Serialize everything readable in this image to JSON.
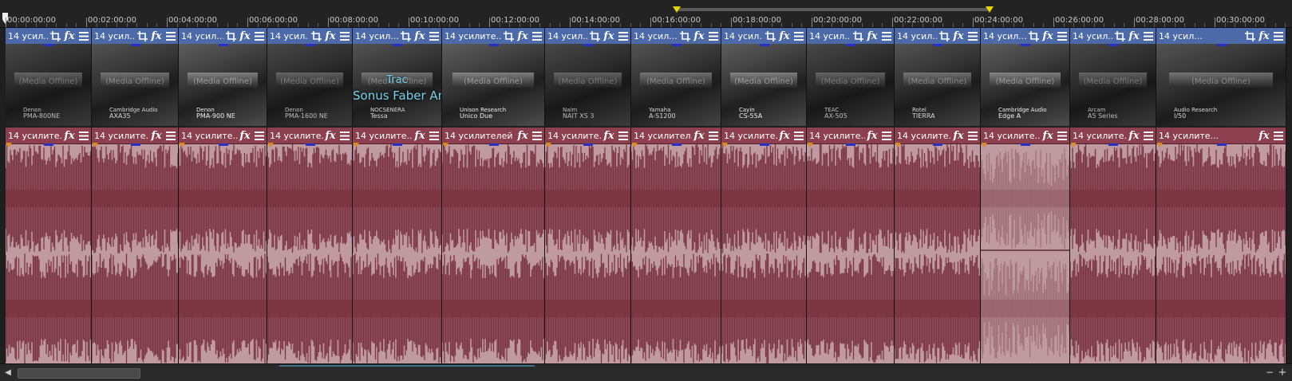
{
  "ruler": {
    "labels": [
      "00:00:00:00",
      "00:02:00:00",
      "00:04:00:00",
      "00:06:00:00",
      "00:08:00:00",
      "00:10:00:00",
      "00:12:00:00",
      "00:14:00:00",
      "00:16:00:00",
      "00:18:00:00",
      "00:20:00:00",
      "00:22:00:00",
      "00:24:00:00",
      "00:26:00:00",
      "00:28:00:00",
      "00:30:00:00"
    ]
  },
  "colors": {
    "video_header": "#4d6aa8",
    "audio_header": "#8c3f4e",
    "waveform": "#7a3442",
    "audio_bg": "#c09aa1",
    "loop_marker": "#e6d200"
  },
  "icons": [
    "crop-icon",
    "fx-icon",
    "menu-icon"
  ],
  "fx_label": "fx",
  "video_clips": [
    {
      "name": "14 усил...",
      "offline": "(Media Offline)",
      "cap1": "Denon",
      "cap2": "PMA-800NE"
    },
    {
      "name": "14 усил...",
      "offline": "(Media Offline)",
      "cap1": "Cambridge Audio",
      "cap2": "AXA35"
    },
    {
      "name": "14 усил...",
      "offline": "(Media Offline)",
      "cap1": "Denon",
      "cap2": "PMA-900 NE"
    },
    {
      "name": "14 усил...",
      "offline": "(Media Offline)",
      "cap1": "Denon",
      "cap2": "PMA-1600 NE"
    },
    {
      "name": "14 усил...",
      "offline": "(Media Offline)",
      "cap1": "NOCSENERA",
      "cap2": "Tessa",
      "overlay1": "Trac",
      "overlay2": "Sonus Faber Ame"
    },
    {
      "name": "14 усилите...",
      "offline": "(Media Offline)",
      "cap1": "Unison Research",
      "cap2": "Unico Due"
    },
    {
      "name": "14 усил...",
      "offline": "(Media Offline)",
      "cap1": "Naim",
      "cap2": "NAIT XS 3"
    },
    {
      "name": "14 усил...",
      "offline": "(Media Offline)",
      "cap1": "Yamaha",
      "cap2": "A-S1200"
    },
    {
      "name": "14 усил...",
      "offline": "(Media Offline)",
      "cap1": "Cayin",
      "cap2": "CS-55A"
    },
    {
      "name": "14 усил...",
      "offline": "(Media Offline)",
      "cap1": "TEAC",
      "cap2": "AX-505"
    },
    {
      "name": "14 усил...",
      "offline": "(Media Offline)",
      "cap1": "Rotel",
      "cap2": "TIERRA"
    },
    {
      "name": "14 усил...",
      "offline": "(Media Offline)",
      "cap1": "Cambridge Audio",
      "cap2": "Edge A"
    },
    {
      "name": "14 усил...",
      "offline": "(Media Offline)",
      "cap1": "Arcam",
      "cap2": "A5 Series"
    },
    {
      "name": "14 усил...",
      "offline": "(Media Offline)",
      "cap1": "Audio Research",
      "cap2": "I/50"
    }
  ],
  "audio_clips": [
    {
      "name": "14 усилите..."
    },
    {
      "name": "14 усилите..."
    },
    {
      "name": "14 усилите..."
    },
    {
      "name": "14 усилите..."
    },
    {
      "name": "14 усилите..."
    },
    {
      "name": "14 усилителей ..."
    },
    {
      "name": "14 усилите..."
    },
    {
      "name": "14 усилител..."
    },
    {
      "name": "14 усилите..."
    },
    {
      "name": "14 усилите..."
    },
    {
      "name": "14 усилите..."
    },
    {
      "name": "14 усилите..."
    },
    {
      "name": "14 усилите..."
    },
    {
      "name": "14 усилите..."
    }
  ],
  "scrollbar": {
    "left_arrow": "◀",
    "zoom_minus": "−",
    "zoom_plus": "+"
  }
}
